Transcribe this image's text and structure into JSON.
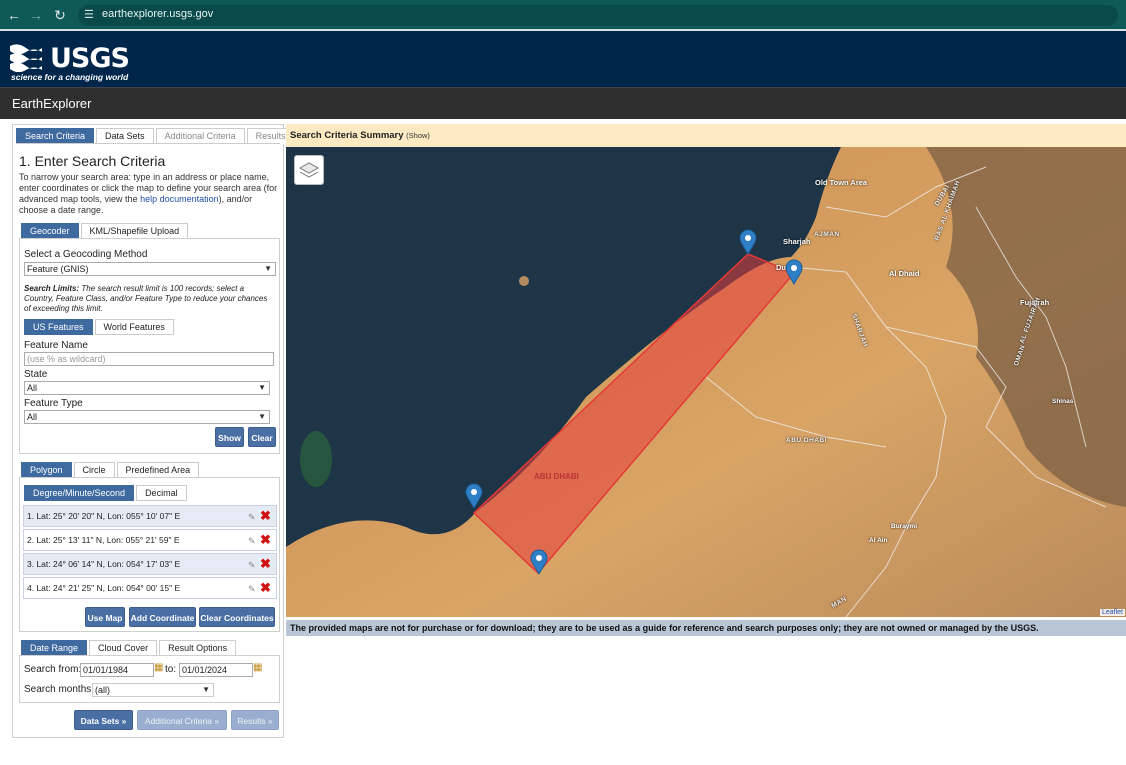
{
  "browser": {
    "url": "earthexplorer.usgs.gov"
  },
  "header": {
    "logo_text": "USGS",
    "tagline": "science for a changing world",
    "app_title": "EarthExplorer"
  },
  "tabs": [
    {
      "label": "Search Criteria",
      "active": true
    },
    {
      "label": "Data Sets",
      "active": false
    },
    {
      "label": "Additional Criteria",
      "active": false
    },
    {
      "label": "Results",
      "active": false
    }
  ],
  "search": {
    "title": "1. Enter Search Criteria",
    "intro_1": "To narrow your search area: type in an address or place name, enter coordinates or click the map to define your search area (for advanced map tools, view the ",
    "intro_link": "help documentation",
    "intro_2": "), and/or choose a date range."
  },
  "geocoder": {
    "tabs": [
      "Geocoder",
      "KML/Shapefile Upload"
    ],
    "method_label": "Select a Geocoding Method",
    "method_value": "Feature (GNIS)",
    "limits_bold": "Search Limits:",
    "limits_text": " The search result limit is 100 records; select a Country, Feature Class, and/or Feature Type to reduce your chances of exceeding this limit.",
    "subtabs": [
      "US Features",
      "World Features"
    ],
    "feature_name_label": "Feature Name",
    "feature_name_placeholder": "(use % as wildcard)",
    "state_label": "State",
    "state_value": "All",
    "feature_type_label": "Feature Type",
    "feature_type_value": "All",
    "show_button": "Show",
    "clear_button": "Clear"
  },
  "shape": {
    "tabs": [
      "Polygon",
      "Circle",
      "Predefined Area"
    ],
    "format_tabs": [
      "Degree/Minute/Second",
      "Decimal"
    ],
    "coordinates": [
      "1.  Lat: 25° 20' 20\" N, Lon: 055° 10' 07\" E",
      "2.  Lat: 25° 13' 11\" N, Lon: 055° 21' 59\" E",
      "3.  Lat: 24° 06' 14\" N, Lon: 054° 17' 03\" E",
      "4.  Lat: 24° 21' 25\" N, Lon: 054° 00' 15\" E"
    ],
    "use_map_button": "Use Map",
    "add_coordinate_button": "Add Coordinate",
    "clear_coordinates_button": "Clear Coordinates"
  },
  "date": {
    "tabs": [
      "Date Range",
      "Cloud Cover",
      "Result Options"
    ],
    "from_label": "Search from:",
    "from_value": "01/01/1984",
    "to_label": "to:",
    "to_value": "01/01/2024",
    "months_label": "Search months:",
    "months_value": "(all)"
  },
  "footer_buttons": {
    "data_sets": "Data Sets »",
    "additional": "Additional Criteria »",
    "results": "Results »"
  },
  "map": {
    "summary_title": "Search Criteria Summary",
    "summary_show": "(Show)",
    "labels": {
      "old_town_area": "Old Town Area",
      "sharjah": "Sharjah",
      "dubai": "Du",
      "al_dhaid": "Al Dhaid",
      "fujairah": "Fujairah",
      "shinas": "Shinas",
      "abu_dhabi_city": "ABU DHABI",
      "abu_dhabi_region": "ABU DHABI",
      "buraymi": "Buraymi",
      "al_ain": "Al Ain",
      "ajman": "AJMAN",
      "fujairah_region": "AL FUJAIRAH",
      "sharjah_region": "SHARJAH",
      "dubai_region": "DUBAI",
      "oman": "OMAN",
      "ras": "RAS AL KHAIMAH",
      "man": "MAN"
    },
    "attribution": "Leaflet",
    "disclaimer": "The provided maps are not for purchase or for download; they are to be used as a guide for reference and search purposes only; they are not owned or managed by the USGS."
  },
  "colors": {
    "header_bg": "#00264c",
    "tab_active": "#3e6aa0",
    "button": "#4a6fa5",
    "polygon": "#e53935",
    "summary_bg": "#fde9c2"
  }
}
